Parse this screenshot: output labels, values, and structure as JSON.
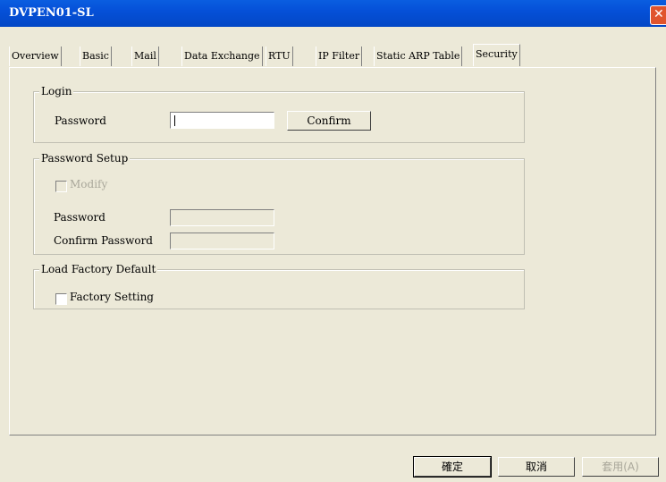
{
  "window": {
    "title": "DVPEN01-SL",
    "close_label": "✕"
  },
  "tabs": [
    {
      "label": "Overview"
    },
    {
      "label": "Basic"
    },
    {
      "label": "Mail"
    },
    {
      "label": "Data Exchange"
    },
    {
      "label": "RTU"
    },
    {
      "label": "IP Filter"
    },
    {
      "label": "Static ARP Table"
    },
    {
      "label": "Security"
    }
  ],
  "active_tab": "Security",
  "login": {
    "group_title": "Login",
    "password_label": "Password",
    "password_value": "",
    "confirm_button": "Confirm"
  },
  "password_setup": {
    "group_title": "Password Setup",
    "modify_label": "Modify",
    "modify_checked": false,
    "password_label": "Password",
    "password_value": "",
    "confirm_password_label": "Confirm Password",
    "confirm_password_value": ""
  },
  "factory_default": {
    "group_title": "Load Factory Default",
    "factory_setting_label": "Factory Setting",
    "factory_setting_checked": false
  },
  "footer": {
    "ok_button": "確定",
    "cancel_button": "取消",
    "apply_button": "套用(A)"
  }
}
